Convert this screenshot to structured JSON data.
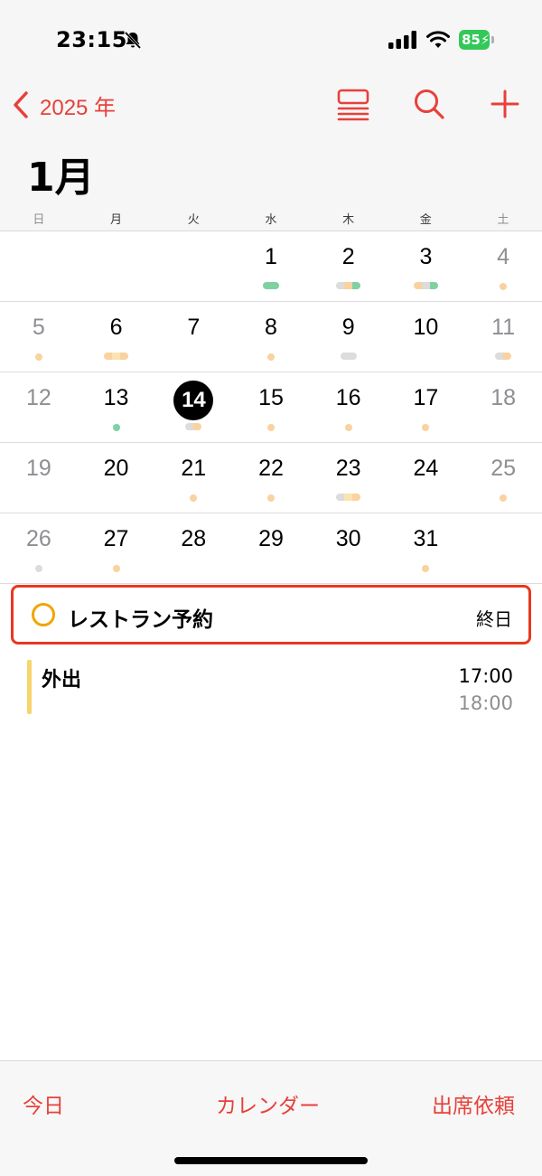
{
  "status_bar": {
    "time": "23:15",
    "battery": "85",
    "icons": [
      "bell-slash-icon",
      "cellular-signal-icon",
      "wifi-icon",
      "battery-charging-icon"
    ]
  },
  "nav": {
    "back_label": "2025 年",
    "icons": [
      "chevron-left-icon",
      "list-view-icon",
      "search-icon",
      "plus-icon"
    ],
    "accent_color": "#e8403a"
  },
  "month_title": "1月",
  "weekdays": [
    "日",
    "月",
    "火",
    "水",
    "木",
    "金",
    "土"
  ],
  "weeks": [
    [
      {
        "day": "",
        "marks": []
      },
      {
        "day": "",
        "marks": []
      },
      {
        "day": "",
        "marks": []
      },
      {
        "day": "1",
        "marks": [
          {
            "kind": "pill",
            "colors": [
              "#7fd1a2"
            ]
          }
        ]
      },
      {
        "day": "2",
        "marks": [
          {
            "kind": "pill",
            "colors": [
              "#dcdcdc",
              "#f9d29f",
              "#7fd1a2"
            ]
          }
        ]
      },
      {
        "day": "3",
        "marks": [
          {
            "kind": "pill",
            "colors": [
              "#f9d29f",
              "#dcdcdc",
              "#7fd1a2"
            ]
          }
        ]
      },
      {
        "day": "4",
        "marks": [
          {
            "kind": "dot",
            "colors": [
              "#f9d29f"
            ]
          }
        ]
      }
    ],
    [
      {
        "day": "5",
        "marks": [
          {
            "kind": "dot",
            "colors": [
              "#f9d29f"
            ]
          }
        ]
      },
      {
        "day": "6",
        "marks": [
          {
            "kind": "pill",
            "colors": [
              "#f9d29f",
              "#fae3b0",
              "#f9d29f"
            ]
          }
        ]
      },
      {
        "day": "7",
        "marks": []
      },
      {
        "day": "8",
        "marks": [
          {
            "kind": "dot",
            "colors": [
              "#f9d29f"
            ]
          }
        ]
      },
      {
        "day": "9",
        "marks": [
          {
            "kind": "pill",
            "colors": [
              "#dcdcdc"
            ]
          }
        ]
      },
      {
        "day": "10",
        "marks": []
      },
      {
        "day": "11",
        "marks": [
          {
            "kind": "pill",
            "colors": [
              "#dcdcdc",
              "#f9d29f"
            ]
          }
        ]
      }
    ],
    [
      {
        "day": "12",
        "marks": []
      },
      {
        "day": "13",
        "marks": [
          {
            "kind": "dot",
            "colors": [
              "#7fd1a2"
            ]
          }
        ]
      },
      {
        "day": "14",
        "today": true,
        "marks": [
          {
            "kind": "pill",
            "colors": [
              "#dcdcdc",
              "#f9d29f"
            ]
          }
        ]
      },
      {
        "day": "15",
        "marks": [
          {
            "kind": "dot",
            "colors": [
              "#f9d29f"
            ]
          }
        ]
      },
      {
        "day": "16",
        "marks": [
          {
            "kind": "dot",
            "colors": [
              "#f9d29f"
            ]
          }
        ]
      },
      {
        "day": "17",
        "marks": [
          {
            "kind": "dot",
            "colors": [
              "#f9d29f"
            ]
          }
        ]
      },
      {
        "day": "18",
        "marks": []
      }
    ],
    [
      {
        "day": "19",
        "marks": []
      },
      {
        "day": "20",
        "marks": []
      },
      {
        "day": "21",
        "marks": [
          {
            "kind": "dot",
            "colors": [
              "#f9d29f"
            ]
          }
        ]
      },
      {
        "day": "22",
        "marks": [
          {
            "kind": "dot",
            "colors": [
              "#f9d29f"
            ]
          }
        ]
      },
      {
        "day": "23",
        "marks": [
          {
            "kind": "pill",
            "colors": [
              "#dcdcdc",
              "#fae3b0",
              "#f9d29f"
            ]
          }
        ]
      },
      {
        "day": "24",
        "marks": []
      },
      {
        "day": "25",
        "marks": [
          {
            "kind": "dot",
            "colors": [
              "#f9d29f"
            ]
          }
        ]
      }
    ],
    [
      {
        "day": "26",
        "marks": [
          {
            "kind": "dot",
            "colors": [
              "#dcdcdc"
            ]
          }
        ]
      },
      {
        "day": "27",
        "marks": [
          {
            "kind": "dot",
            "colors": [
              "#f9d29f"
            ]
          }
        ]
      },
      {
        "day": "28",
        "marks": []
      },
      {
        "day": "29",
        "marks": []
      },
      {
        "day": "30",
        "marks": []
      },
      {
        "day": "31",
        "marks": [
          {
            "kind": "dot",
            "colors": [
              "#f9d29f"
            ]
          }
        ]
      },
      {
        "day": "",
        "marks": []
      }
    ]
  ],
  "events": [
    {
      "title": "レストラン予約",
      "time": "終日",
      "color": "#f0a500",
      "highlight_color": "#e8381f"
    },
    {
      "title": "外出",
      "start": "17:00",
      "end": "18:00",
      "color": "#f6d56b"
    }
  ],
  "toolbar": {
    "today": "今日",
    "calendars": "カレンダー",
    "inbox": "出席依頼"
  }
}
